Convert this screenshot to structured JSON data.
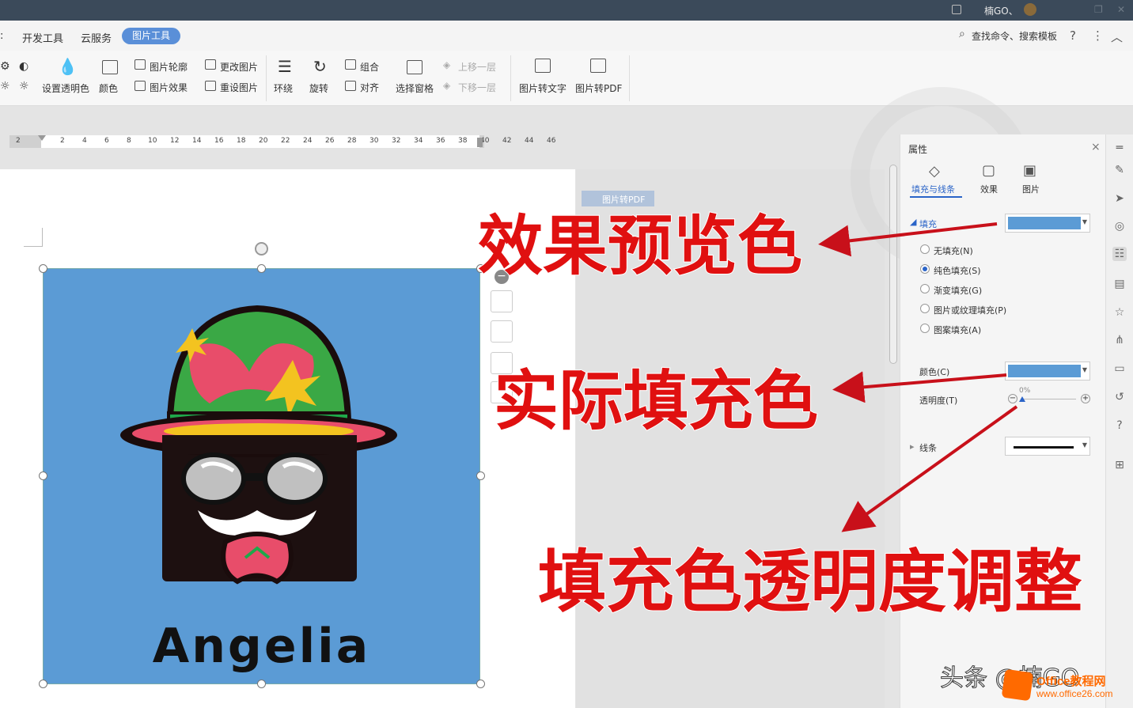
{
  "topbar": {
    "user": "楠GO、"
  },
  "menubar": {
    "tabs": [
      ":",
      "开发工具",
      "云服务",
      "图片工具"
    ],
    "search": "查找命令、搜索模板",
    "help": "?",
    "more": "⋮",
    "collapse": "︿"
  },
  "ribbon": {
    "set_transparent": "设置透明色",
    "color": "颜色",
    "outline": "图片轮廓",
    "effect": "图片效果",
    "change": "更改图片",
    "reset": "重设图片",
    "wrap": "环绕",
    "rotate": "旋转",
    "group": "组合",
    "align": "对齐",
    "select_pane": "选择窗格",
    "bring_forward": "上移一层",
    "send_backward": "下移一层",
    "to_text": "图片转文字",
    "to_pdf": "图片转PDF"
  },
  "ruler": {
    "ticks": [
      "2",
      "2",
      "4",
      "6",
      "8",
      "10",
      "12",
      "14",
      "16",
      "18",
      "20",
      "22",
      "24",
      "26",
      "28",
      "30",
      "32",
      "34",
      "36",
      "38",
      "40",
      "42",
      "44",
      "46"
    ]
  },
  "document": {
    "logo_text": "Angelia",
    "floating_tag": "图片转PDF"
  },
  "panel": {
    "title": "属性",
    "tabs": [
      "填充与线条",
      "效果",
      "图片"
    ],
    "fill_section": "填充",
    "fill_options": [
      "无填充(N)",
      "纯色填充(S)",
      "渐变填充(G)",
      "图片或纹理填充(P)",
      "图案填充(A)"
    ],
    "selected_fill": "纯色填充(S)",
    "color_label": "颜色(C)",
    "transparency_label": "透明度(T)",
    "transparency_value": "0%",
    "line_section": "线条",
    "fill_color": "#5b9bd5"
  },
  "annotations": {
    "preview_color": "效果预览色",
    "actual_fill": "实际填充色",
    "transparency_adjust": "填充色透明度调整",
    "arrow_color": "#c8101a"
  },
  "watermark": {
    "source": "头条 @楠GO",
    "site_name": "Office教程网",
    "site_url": "www.office26.com"
  }
}
